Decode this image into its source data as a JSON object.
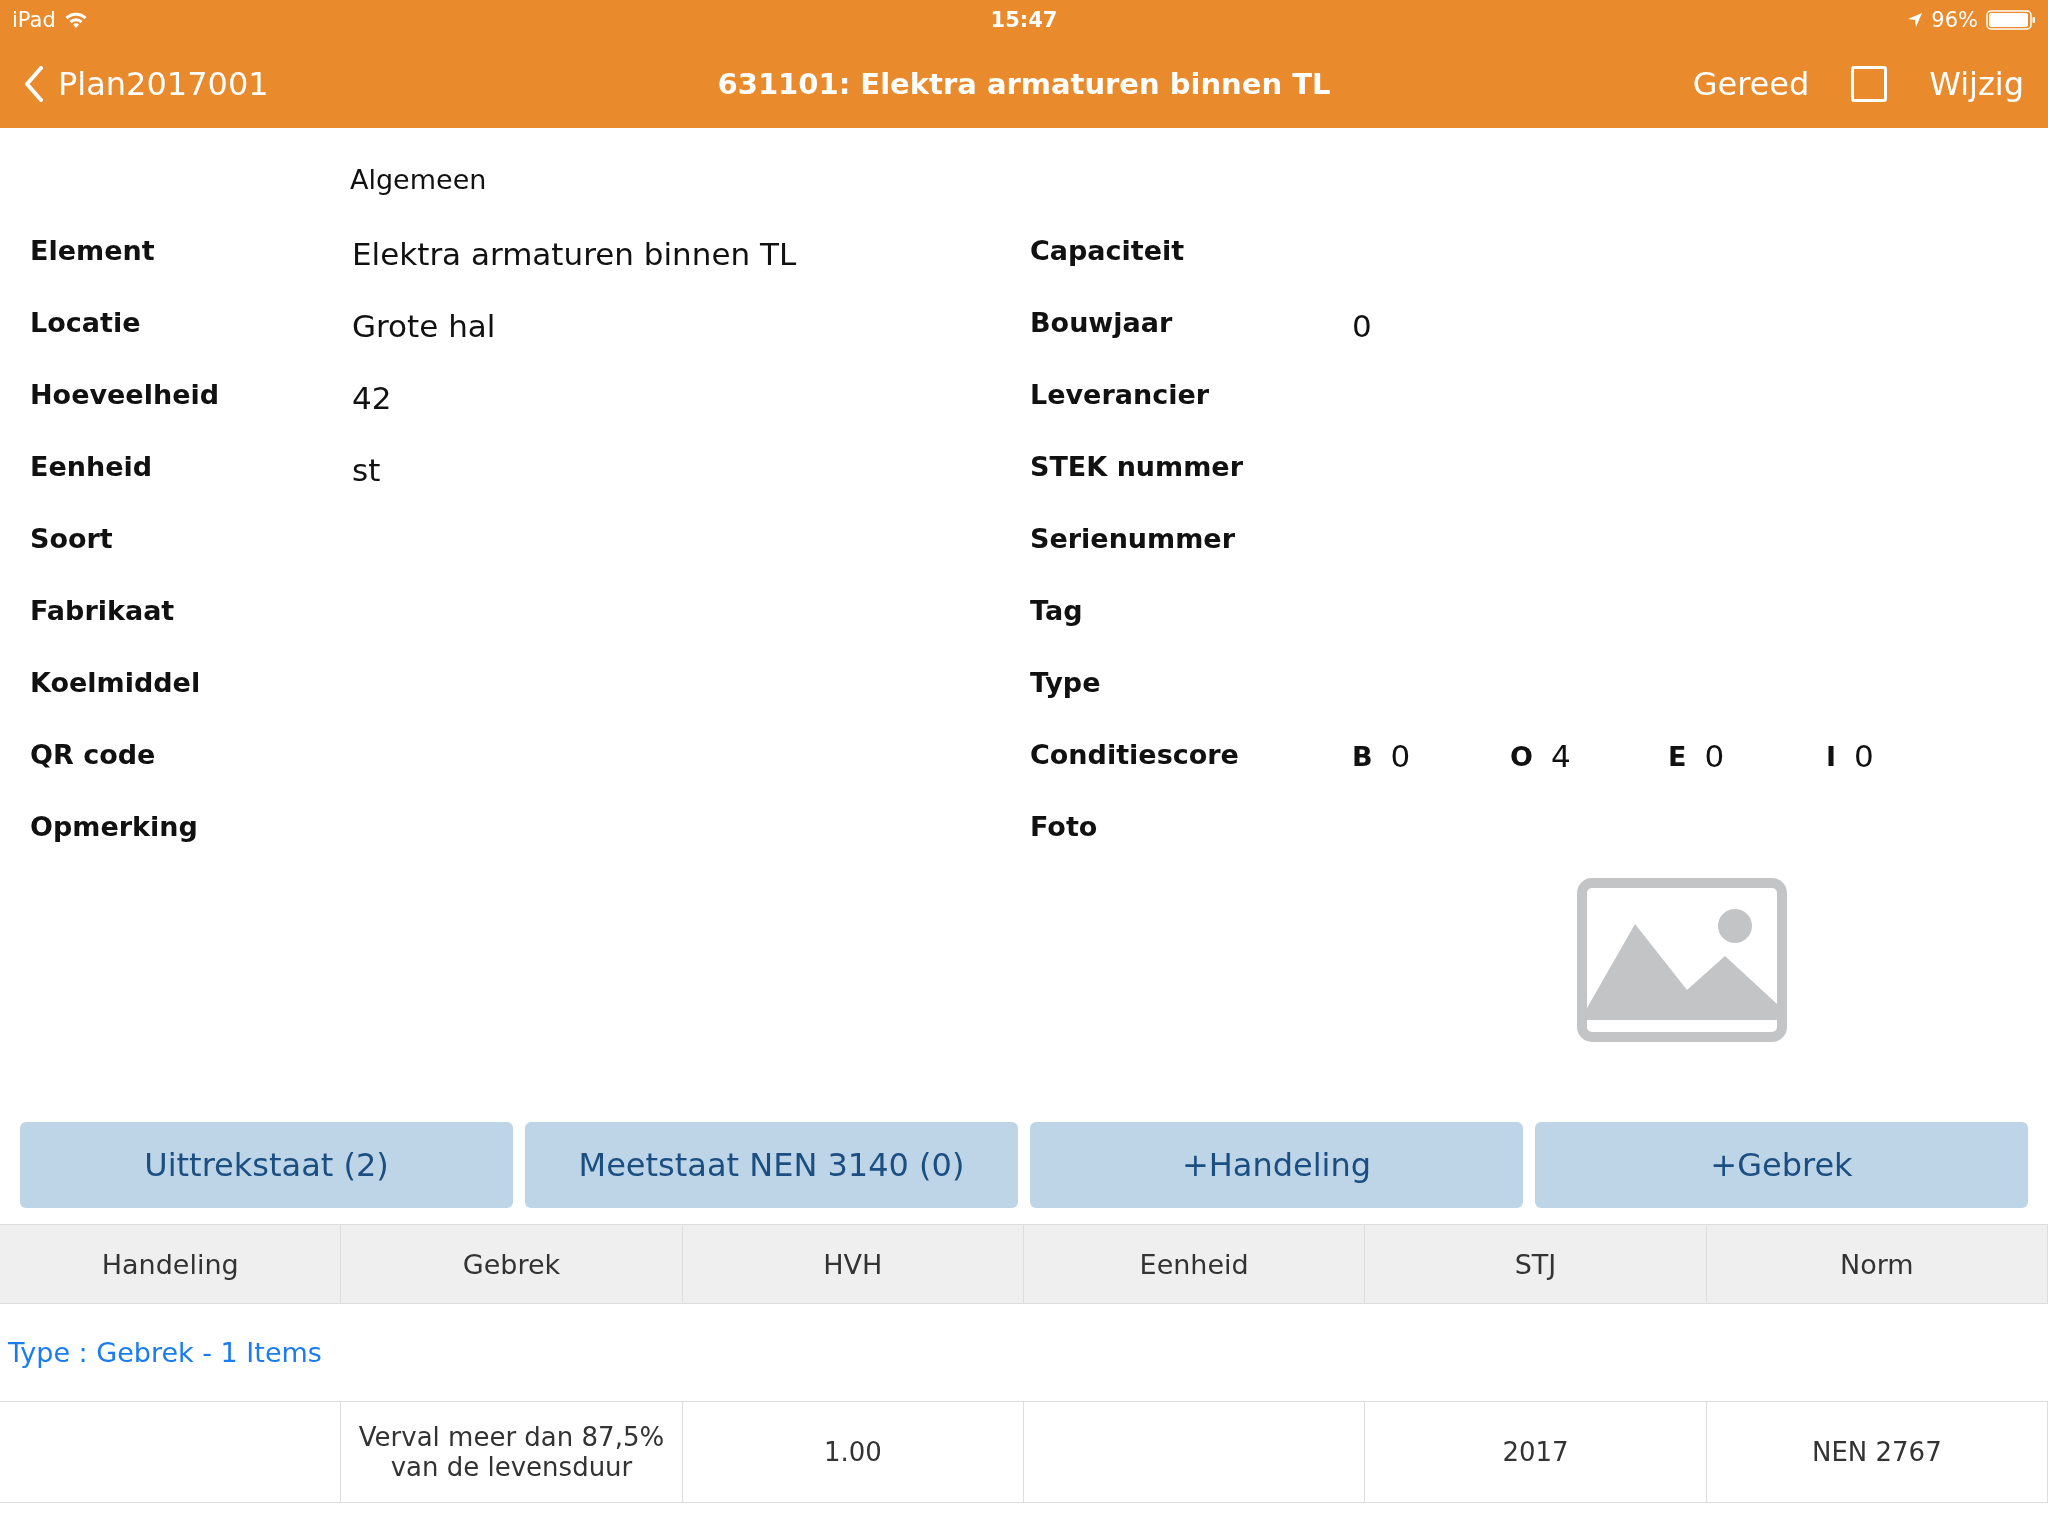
{
  "status_bar": {
    "carrier": "iPad",
    "time": "15:47",
    "battery": "96%"
  },
  "nav_bar": {
    "back": "Plan2017001",
    "title": "631101: Elektra armaturen binnen TL",
    "done": "Gereed",
    "checkbox": {
      "checked": false
    },
    "edit": "Wijzig"
  },
  "section": "Algemeen",
  "left_fields": [
    {
      "label": "Element",
      "value": "Elektra armaturen binnen TL"
    },
    {
      "label": "Locatie",
      "value": "Grote hal"
    },
    {
      "label": "Hoeveelheid",
      "value": "42"
    },
    {
      "label": "Eenheid",
      "value": "st"
    },
    {
      "label": "Soort"
    },
    {
      "label": "Fabrikaat"
    },
    {
      "label": "Koelmiddel"
    },
    {
      "label": "QR code"
    },
    {
      "label": "Opmerking"
    }
  ],
  "right_fields": [
    {
      "kind": "text",
      "label": "Capaciteit"
    },
    {
      "kind": "text",
      "label": "Bouwjaar",
      "value": "0"
    },
    {
      "kind": "text",
      "label": "Leverancier"
    },
    {
      "kind": "text",
      "label": "STEK nummer"
    },
    {
      "kind": "text",
      "label": "Serienummer"
    },
    {
      "kind": "text",
      "label": "Tag"
    },
    {
      "kind": "text",
      "label": "Type"
    },
    {
      "kind": "score",
      "label": "Conditiescore",
      "scores": [
        {
          "letter": "B",
          "value": "0"
        },
        {
          "letter": "O",
          "value": "4"
        },
        {
          "letter": "E",
          "value": "0"
        },
        {
          "letter": "I",
          "value": "0"
        }
      ]
    },
    {
      "kind": "photo",
      "label": "Foto"
    }
  ],
  "buttons": [
    "Uittrekstaat (2)",
    "Meetstaat NEN 3140 (0)",
    "+Handeling",
    "+Gebrek"
  ],
  "table": {
    "columns": [
      "Handeling",
      "Gebrek",
      "HVH",
      "Eenheid",
      "STJ",
      "Norm"
    ],
    "group": "Type : Gebrek - 1 Items",
    "rows": [
      [
        "",
        "Verval meer dan  87,5% van de levensduur",
        "1.00",
        "",
        "2017",
        "NEN 2767"
      ]
    ]
  }
}
